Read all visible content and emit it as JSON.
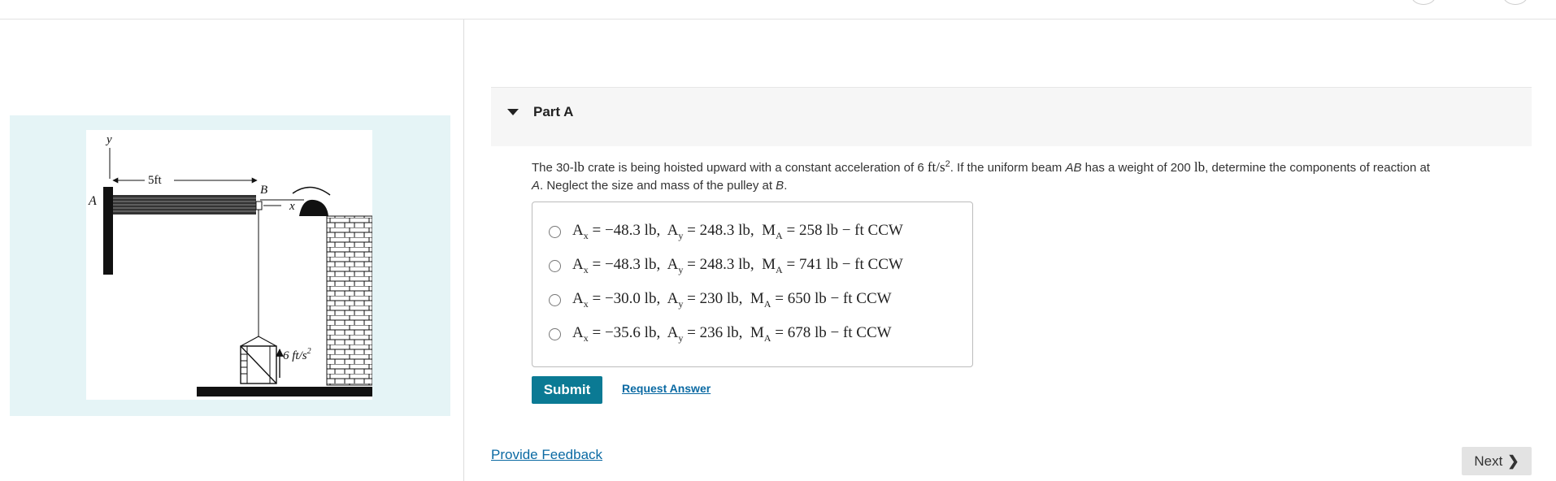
{
  "part": {
    "title": "Part A"
  },
  "question": {
    "t1": "The 30-",
    "u_lb1": "lb",
    "t2": " crate is being hoisted upward with a constant acceleration of 6 ",
    "u_accel": "ft/s",
    "u_accel_exp": "2",
    "t3": ". If the uniform beam ",
    "beam": "AB",
    "t4": " has a weight of 200 ",
    "u_lb2": "lb",
    "t5": ", determine the components of reaction at ",
    "point": "A",
    "t6": ". Neglect the size and mass of the pulley at ",
    "pulley": "B",
    "t7": "."
  },
  "choices": [
    {
      "ax": "−48.3 lb",
      "ay": "248.3 lb",
      "ma": "258 lb − ft CCW"
    },
    {
      "ax": "−48.3 lb",
      "ay": "248.3 lb",
      "ma": "741 lb − ft CCW"
    },
    {
      "ax": "−30.0 lb",
      "ay": "230 lb",
      "ma": "650 lb − ft CCW"
    },
    {
      "ax": "−35.6 lb",
      "ay": "236 lb",
      "ma": "678 lb − ft CCW"
    }
  ],
  "figure": {
    "label_y": "y",
    "label_5ft": "5ft",
    "label_A": "A",
    "label_B": "B",
    "label_x": "x",
    "label_accel": "6 ft/s",
    "label_accel_exp": "2"
  },
  "buttons": {
    "submit": "Submit",
    "request_answer": "Request Answer",
    "provide_feedback": "Provide Feedback",
    "next": "Next"
  }
}
